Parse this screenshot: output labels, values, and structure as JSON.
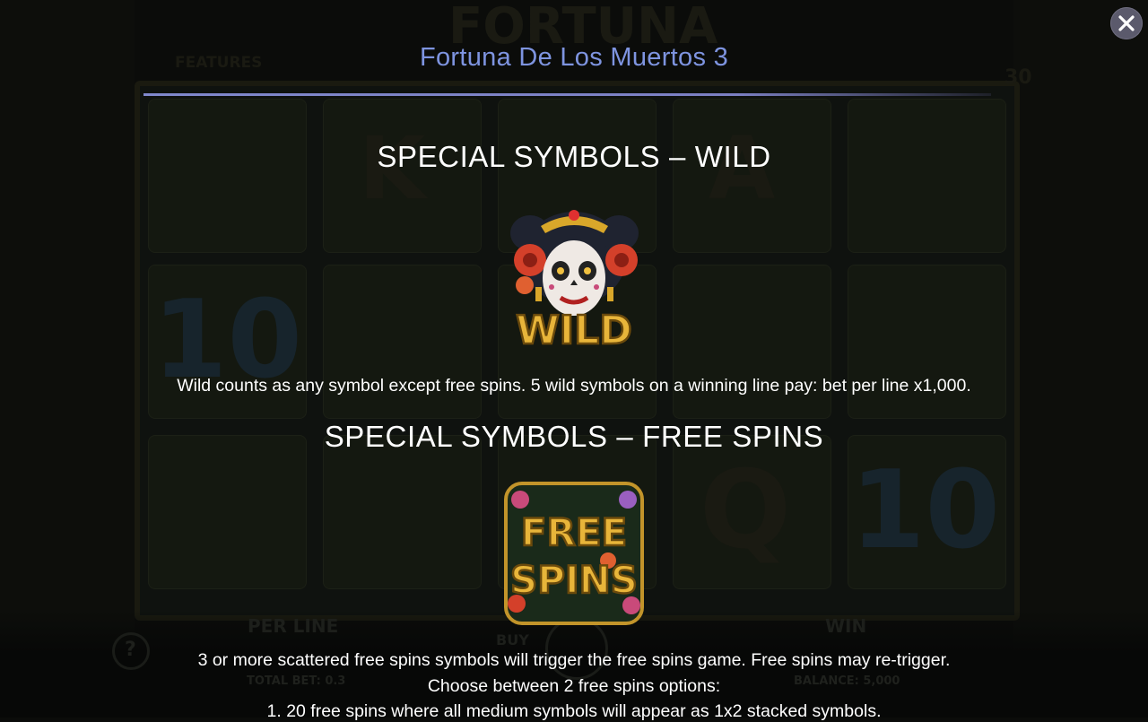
{
  "window": {
    "title": "Fortuna De Los Muertos 3"
  },
  "close_button": {
    "icon": "close-icon"
  },
  "sections": [
    {
      "heading": "SPECIAL SYMBOLS – WILD",
      "symbol": {
        "icon": "wild-catrina-symbol",
        "label": "WILD"
      },
      "description": "Wild counts as any symbol except free spins. 5 wild symbols on a winning line pay: bet per line x1,000."
    },
    {
      "heading": "SPECIAL SYMBOLS – FREE SPINS",
      "symbol": {
        "icon": "free-spins-symbol",
        "label_line1": "FREE",
        "label_line2": "SPINS"
      },
      "description_lines": [
        "3 or more scattered free spins symbols will trigger the free spins game. Free spins may re-trigger.",
        "Choose between 2 free spins options:",
        "1. 20 free spins where all medium symbols will appear as 1x2 stacked symbols."
      ]
    }
  ],
  "background": {
    "logo_text": "FORTUNA",
    "features_label": "FEATURES",
    "counter": "30",
    "per_line_label": "PER LINE",
    "buy_label": "BUY",
    "win_label": "WIN",
    "total_bet_label": "TOTAL BET: 0.3",
    "balance_label": "BALANCE: 5,000",
    "help_icon": "?",
    "reel_symbols": [
      "K",
      "A",
      "10",
      "Q",
      "10"
    ]
  },
  "colors": {
    "title": "#7e94e0",
    "divider": "#8088cc",
    "text": "#ffffff",
    "gold": "#e8b53a",
    "close_bg": "#5b5a6c"
  }
}
